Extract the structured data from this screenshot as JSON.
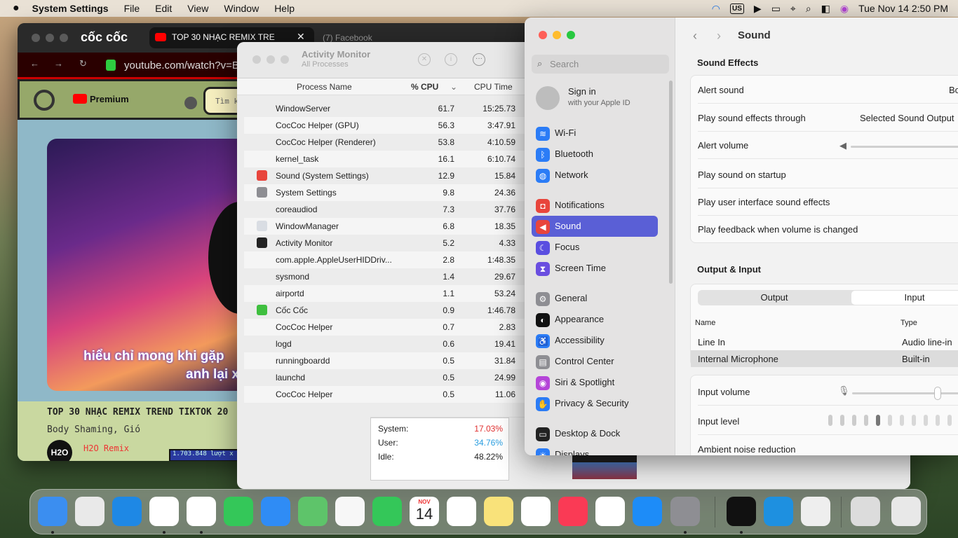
{
  "menubar": {
    "app": "System Settings",
    "items": [
      "File",
      "Edit",
      "View",
      "Window",
      "Help"
    ],
    "input_source": "US",
    "datetime": "Tue Nov 14  2:50 PM"
  },
  "browser": {
    "brand": "cốc cốc",
    "tab_active": "TOP 30 NHẠC REMIX TRE",
    "tab_other": "(7) Facebook",
    "url": "youtube.com/watch?v=B",
    "yt_badge": "Premium",
    "search_placeholder": "Tìm ki",
    "subtitle1": "hiểu chỉ mong khi gặp",
    "subtitle2": "anh lại x",
    "video_title": "TOP 30 NHẠC REMIX TREND TIKTOK 20",
    "video_tags": "Body Shaming, Gió",
    "channel_name": "H2O Remix",
    "channel_logo": "H2O",
    "views": "1.703.848 lượt x"
  },
  "activity": {
    "title": "Activity Monitor",
    "subtitle": "All Processes",
    "col_name": "Process Name",
    "col_cpu": "% CPU",
    "col_time": "CPU Time",
    "rows": [
      {
        "name": "WindowServer",
        "cpu": "61.7",
        "time": "15:25.73",
        "icon": ""
      },
      {
        "name": "CocCoc Helper (GPU)",
        "cpu": "56.3",
        "time": "3:47.91",
        "icon": ""
      },
      {
        "name": "CocCoc Helper (Renderer)",
        "cpu": "53.8",
        "time": "4:10.59",
        "icon": ""
      },
      {
        "name": "kernel_task",
        "cpu": "16.1",
        "time": "6:10.74",
        "icon": ""
      },
      {
        "name": "Sound (System Settings)",
        "cpu": "12.9",
        "time": "15.84",
        "icon": "sound"
      },
      {
        "name": "System Settings",
        "cpu": "9.8",
        "time": "24.36",
        "icon": "gear"
      },
      {
        "name": "coreaudiod",
        "cpu": "7.3",
        "time": "37.76",
        "icon": ""
      },
      {
        "name": "WindowManager",
        "cpu": "6.8",
        "time": "18.35",
        "icon": "window"
      },
      {
        "name": "Activity Monitor",
        "cpu": "5.2",
        "time": "4.33",
        "icon": "monitor"
      },
      {
        "name": "com.apple.AppleUserHIDDriv...",
        "cpu": "2.8",
        "time": "1:48.35",
        "icon": ""
      },
      {
        "name": "sysmond",
        "cpu": "1.4",
        "time": "29.67",
        "icon": ""
      },
      {
        "name": "airportd",
        "cpu": "1.1",
        "time": "53.24",
        "icon": ""
      },
      {
        "name": "Cốc Cốc",
        "cpu": "0.9",
        "time": "1:46.78",
        "icon": "coccoc"
      },
      {
        "name": "CocCoc Helper",
        "cpu": "0.7",
        "time": "2.83",
        "icon": ""
      },
      {
        "name": "logd",
        "cpu": "0.6",
        "time": "19.41",
        "icon": ""
      },
      {
        "name": "runningboardd",
        "cpu": "0.5",
        "time": "31.84",
        "icon": ""
      },
      {
        "name": "launchd",
        "cpu": "0.5",
        "time": "24.99",
        "icon": ""
      },
      {
        "name": "CocCoc Helper",
        "cpu": "0.5",
        "time": "11.06",
        "icon": ""
      }
    ],
    "summary": {
      "system_label": "System:",
      "system_val": "17.03%",
      "user_label": "User:",
      "user_val": "34.76%",
      "idle_label": "Idle:",
      "idle_val": "48.22%"
    }
  },
  "settings": {
    "search_placeholder": "Search",
    "signin": "Sign in",
    "signin_sub": "with your Apple ID",
    "sidebar": [
      {
        "label": "Wi-Fi",
        "color": "#2b7cf6",
        "glyph": "≋"
      },
      {
        "label": "Bluetooth",
        "color": "#2b7cf6",
        "glyph": "ᛒ"
      },
      {
        "label": "Network",
        "color": "#2b7cf6",
        "glyph": "◍"
      },
      {
        "label": "Notifications",
        "color": "#e8453c",
        "glyph": "◘"
      },
      {
        "label": "Sound",
        "color": "#e8453c",
        "glyph": "◀"
      },
      {
        "label": "Focus",
        "color": "#5a4ee0",
        "glyph": "☾"
      },
      {
        "label": "Screen Time",
        "color": "#6a4ee0",
        "glyph": "⧗"
      },
      {
        "label": "General",
        "color": "#8e8e93",
        "glyph": "⚙"
      },
      {
        "label": "Appearance",
        "color": "#111111",
        "glyph": "◐"
      },
      {
        "label": "Accessibility",
        "color": "#2b7cf6",
        "glyph": "♿"
      },
      {
        "label": "Control Center",
        "color": "#8e8e93",
        "glyph": "▤"
      },
      {
        "label": "Siri & Spotlight",
        "color": "#b545d8",
        "glyph": "◉"
      },
      {
        "label": "Privacy & Security",
        "color": "#2b7cf6",
        "glyph": "✋"
      },
      {
        "label": "Desktop & Dock",
        "color": "#222222",
        "glyph": "▭"
      },
      {
        "label": "Displays",
        "color": "#2b7cf6",
        "glyph": "☀"
      }
    ],
    "page_title": "Sound",
    "sound_effects_header": "Sound Effects",
    "alert_sound": "Alert sound",
    "alert_sound_val": "Bo",
    "play_through": "Play sound effects through",
    "play_through_val": "Selected Sound Output",
    "alert_volume": "Alert volume",
    "startup": "Play sound on startup",
    "ui_effects": "Play user interface sound effects",
    "feedback": "Play feedback when volume is changed",
    "oi_header": "Output & Input",
    "tab_output": "Output",
    "tab_input": "Input",
    "col_name": "Name",
    "col_type": "Type",
    "devices": [
      {
        "name": "Line In",
        "type": "Audio line-in"
      },
      {
        "name": "Internal Microphone",
        "type": "Built-in"
      }
    ],
    "input_volume": "Input volume",
    "input_volume_level": 0.72,
    "input_level": "Input level",
    "input_level_value": 5,
    "ambient": "Ambient noise reduction"
  },
  "dock": {
    "items": [
      "finder-icon",
      "launchpad-icon",
      "safari-icon",
      "chrome-icon",
      "coccoc-icon",
      "messages-icon",
      "mail-icon",
      "maps-icon",
      "photos-icon",
      "facetime-icon",
      "calendar-icon",
      "reminders-icon",
      "notes-icon",
      "freeform-icon",
      "music-icon",
      "news-icon",
      "appstore-icon",
      "settings-icon",
      "activity-monitor-icon",
      "coccoc-update-icon",
      "system-info-icon",
      "disk-utility-icon",
      "trash-icon"
    ],
    "calendar_month": "NOV",
    "calendar_day": "14"
  }
}
